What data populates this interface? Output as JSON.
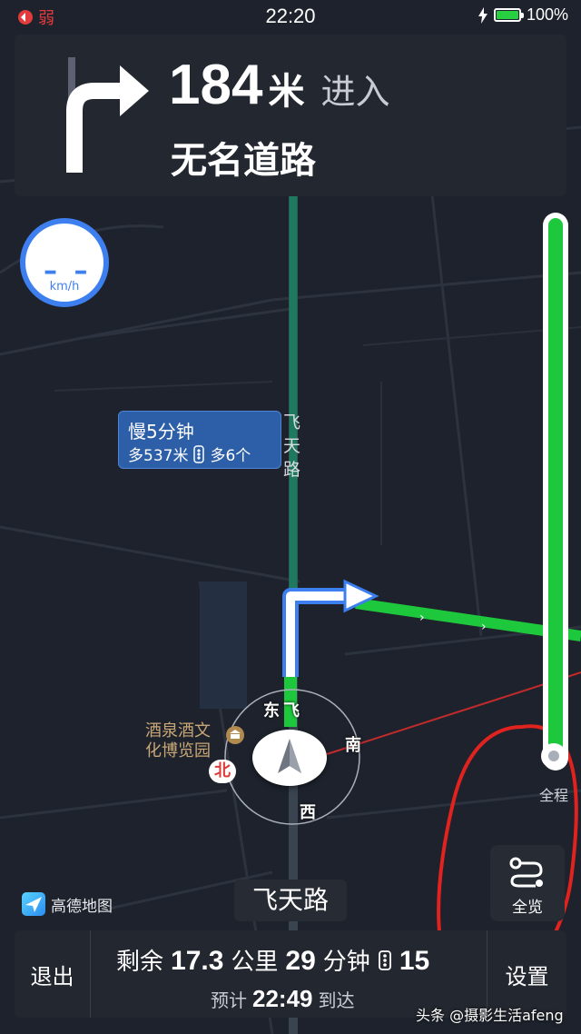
{
  "status_bar": {
    "signal_label": "弱",
    "time": "22:20",
    "battery_percent": "100%",
    "battery_level": 1.0
  },
  "guidance": {
    "distance": "184",
    "distance_unit": "米",
    "action": "进入",
    "road_name": "无名道路"
  },
  "speed": {
    "value": "– –",
    "unit": "km/h"
  },
  "alt_route": {
    "line1": "慢5分钟",
    "line2_a": "多537米",
    "line2_b": "多6个"
  },
  "map_labels": {
    "road_vertical": "飞天路",
    "poi": "酒泉酒文化博览园",
    "poi_line1": "酒泉酒文",
    "poi_line2": "化博览园",
    "east": "东",
    "south": "南",
    "west": "西",
    "north": "北",
    "road_chunk": "飞"
  },
  "progress": {
    "completed_fraction": 1.0,
    "label": "全程"
  },
  "overview_button": {
    "label": "全览"
  },
  "logo": {
    "text": "高德地图"
  },
  "current_road": "飞天路",
  "bottom_bar": {
    "exit": "退出",
    "remain_prefix": "剩余",
    "remain_distance": "17.3",
    "remain_distance_unit": "公里",
    "remain_time": "29",
    "remain_time_unit": "分钟",
    "traffic_lights": "15",
    "eta_prefix": "预计",
    "eta_time": "22:49",
    "eta_suffix": "到达",
    "settings": "设置"
  },
  "watermark": "头条 @摄影生活afeng",
  "colors": {
    "route_green": "#1ec83c",
    "accent_blue": "#3e7ff0",
    "annotation_red": "#e0231f"
  }
}
